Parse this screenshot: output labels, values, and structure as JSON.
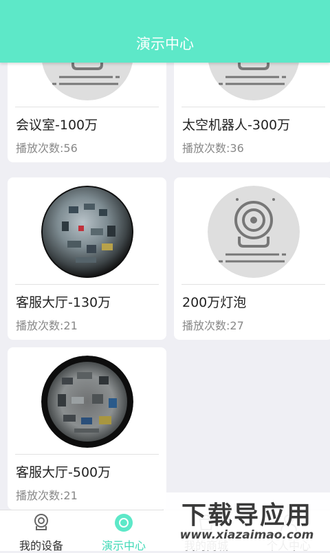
{
  "header": {
    "title": "演示中心"
  },
  "devices": [
    {
      "name": "会议室-100万",
      "plays_label": "播放次数:",
      "plays": "56",
      "thumbnail": "placeholder-camera-icon"
    },
    {
      "name": "太空机器人-300万",
      "plays_label": "播放次数:",
      "plays": "36",
      "thumbnail": "placeholder-camera-icon"
    },
    {
      "name": "客服大厅-130万",
      "plays_label": "播放次数:",
      "plays": "21",
      "thumbnail": "fisheye-office-view"
    },
    {
      "name": "200万灯泡",
      "plays_label": "播放次数:",
      "plays": "27",
      "thumbnail": "placeholder-camera-icon"
    },
    {
      "name": "客服大厅-500万",
      "plays_label": "播放次数:",
      "plays": "21",
      "thumbnail": "fisheye-office-view"
    }
  ],
  "tabbar": {
    "tabs": [
      {
        "label": "我的设备",
        "icon": "camera-icon",
        "active": false
      },
      {
        "label": "演示中心",
        "icon": "demo-circle-icon",
        "active": true
      },
      {
        "label": "我的商城",
        "icon": "shop-icon",
        "active": false
      },
      {
        "label": "个人中心",
        "icon": "user-icon",
        "active": false
      }
    ]
  },
  "watermark": {
    "title": "下载导应用",
    "url": "www.xiazaimao.com"
  },
  "colors": {
    "accent": "#5de8c8",
    "active_tab": "#3ed9b6",
    "background": "#efeff4"
  }
}
